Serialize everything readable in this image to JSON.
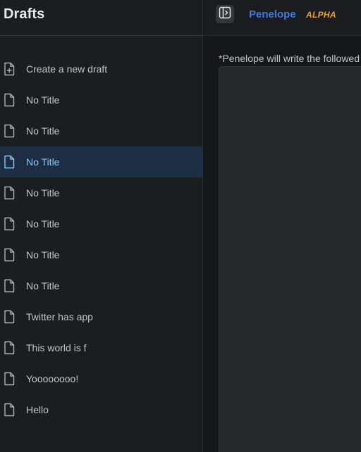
{
  "sidebar": {
    "title": "Drafts",
    "items": [
      {
        "label": "Create a new draft",
        "icon": "file-plus-icon"
      },
      {
        "label": "No Title",
        "icon": "file-icon"
      },
      {
        "label": "No Title",
        "icon": "file-icon"
      },
      {
        "label": "No Title",
        "icon": "file-icon",
        "selected": true
      },
      {
        "label": "No Title",
        "icon": "file-icon"
      },
      {
        "label": "No Title",
        "icon": "file-icon"
      },
      {
        "label": "No Title",
        "icon": "file-icon"
      },
      {
        "label": "No Title",
        "icon": "file-icon"
      },
      {
        "label": "Twitter has app",
        "icon": "file-icon"
      },
      {
        "label": "This world is f",
        "icon": "file-icon"
      },
      {
        "label": "Yoooooooo!",
        "icon": "file-icon"
      },
      {
        "label": "Hello",
        "icon": "file-icon"
      }
    ]
  },
  "header": {
    "toggle_icon": "sidebar-toggle-icon",
    "brand": "Penelope",
    "brand_tag": "ALPHA",
    "brand_color": "#3b7bdc",
    "tag_color": "#e7a526"
  },
  "main": {
    "note": "*Penelope will write the followed"
  },
  "colors": {
    "selected_bg": "#1c2d44",
    "selected_text": "#8ec7f5"
  }
}
